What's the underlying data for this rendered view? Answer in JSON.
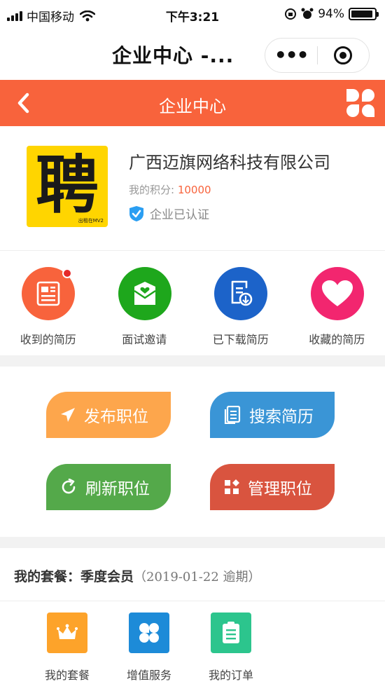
{
  "status_bar": {
    "carrier": "中国移动",
    "time": "下午3:21",
    "battery": "94%",
    "battery_level": 0.94
  },
  "header": {
    "title": "企业中心 -...",
    "more_icon": "more-dots-icon",
    "close_icon": "target-circle-icon"
  },
  "nav": {
    "title": "企业中心",
    "back_icon": "chevron-left-icon",
    "menu_icon": "grid-clover-icon",
    "color": "#f8633c"
  },
  "company": {
    "logo_char": "聘",
    "logo_small": "出租在MV2",
    "name": "广西迈旗网络科技有限公司",
    "points_label": "我的积分: ",
    "points_value": "10000",
    "verified_text": "企业已认证"
  },
  "resume_items": [
    {
      "label": "收到的简历",
      "icon": "resume-icon",
      "color": "#f8633c",
      "badge": true
    },
    {
      "label": "面试邀请",
      "icon": "envelope-icon",
      "color": "#1ea71c",
      "badge": false
    },
    {
      "label": "已下载简历",
      "icon": "download-doc-icon",
      "color": "#1c63c9",
      "badge": false
    },
    {
      "label": "收藏的简历",
      "icon": "heart-icon",
      "color": "#f2266f",
      "badge": false
    }
  ],
  "actions": [
    {
      "label": "发布职位",
      "icon": "paper-plane-icon",
      "color": "#fda64c"
    },
    {
      "label": "搜索简历",
      "icon": "document-icon",
      "color": "#3a95d6"
    },
    {
      "label": "刷新职位",
      "icon": "refresh-icon",
      "color": "#54a94a"
    },
    {
      "label": "管理职位",
      "icon": "grid-icon",
      "color": "#d9543f"
    }
  ],
  "package": {
    "label": "我的套餐：季度会员",
    "expiry": "（2019-01-22 逾期）"
  },
  "bottom_items": [
    {
      "label": "我的套餐",
      "icon": "crown-icon",
      "color": "#fda32a"
    },
    {
      "label": "增值服务",
      "icon": "clover-icon",
      "color": "#1d8bd8"
    },
    {
      "label": "我的订单",
      "icon": "clipboard-icon",
      "color": "#2cc58d"
    }
  ]
}
